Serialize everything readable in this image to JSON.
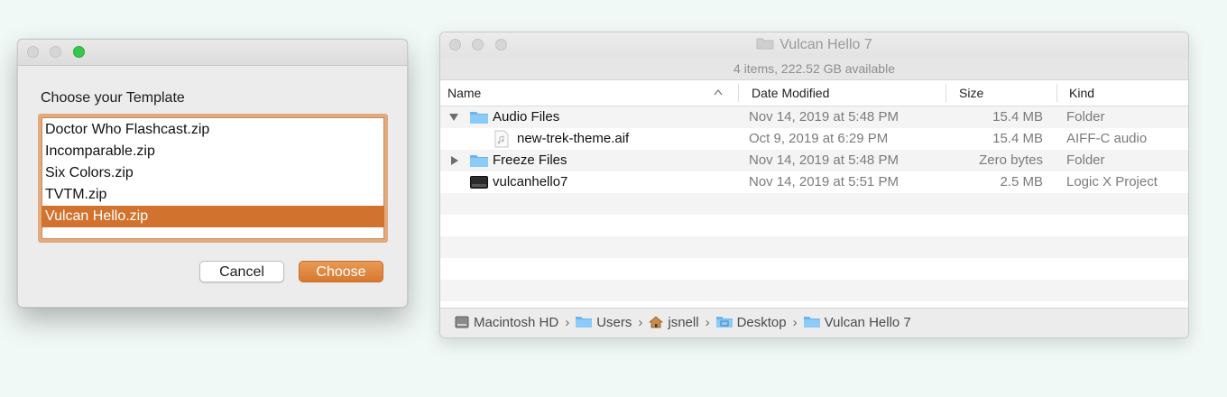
{
  "dialog": {
    "prompt": "Choose your Template",
    "items": [
      {
        "label": "Doctor Who Flashcast.zip",
        "selected": false
      },
      {
        "label": "Incomparable.zip",
        "selected": false
      },
      {
        "label": "Six Colors.zip",
        "selected": false
      },
      {
        "label": "TVTM.zip",
        "selected": false
      },
      {
        "label": "Vulcan Hello.zip",
        "selected": true
      }
    ],
    "cancel_label": "Cancel",
    "choose_label": "Choose"
  },
  "finder": {
    "title": "Vulcan Hello 7",
    "status": "4 items, 222.52 GB available",
    "columns": {
      "name": "Name",
      "date": "Date Modified",
      "size": "Size",
      "kind": "Kind"
    },
    "rows": [
      {
        "name": "Audio Files",
        "date": "Nov 14, 2019 at 5:48 PM",
        "size": "15.4 MB",
        "kind": "Folder",
        "icon": "folder-icon",
        "disclosure": "expanded"
      },
      {
        "name": "new-trek-theme.aif",
        "date": "Oct 9, 2019 at 6:29 PM",
        "size": "15.4 MB",
        "kind": "AIFF-C audio",
        "icon": "audio-file-icon",
        "disclosure": "none"
      },
      {
        "name": "Freeze Files",
        "date": "Nov 14, 2019 at 5:48 PM",
        "size": "Zero bytes",
        "kind": "Folder",
        "icon": "folder-icon",
        "disclosure": "collapsed"
      },
      {
        "name": "vulcanhello7",
        "date": "Nov 14, 2019 at 5:51 PM",
        "size": "2.5 MB",
        "kind": "Logic X Project",
        "icon": "logic-project-icon",
        "disclosure": "none"
      }
    ],
    "path": [
      {
        "label": "Macintosh HD",
        "icon": "hard-drive-icon"
      },
      {
        "label": "Users",
        "icon": "folder-icon"
      },
      {
        "label": "jsnell",
        "icon": "home-icon"
      },
      {
        "label": "Desktop",
        "icon": "desktop-folder-icon"
      },
      {
        "label": "Vulcan Hello 7",
        "icon": "folder-icon"
      }
    ]
  },
  "colors": {
    "accent": "#d1732e",
    "folder_blue": "#6cb4f0",
    "traffic_green": "#35c94a"
  }
}
